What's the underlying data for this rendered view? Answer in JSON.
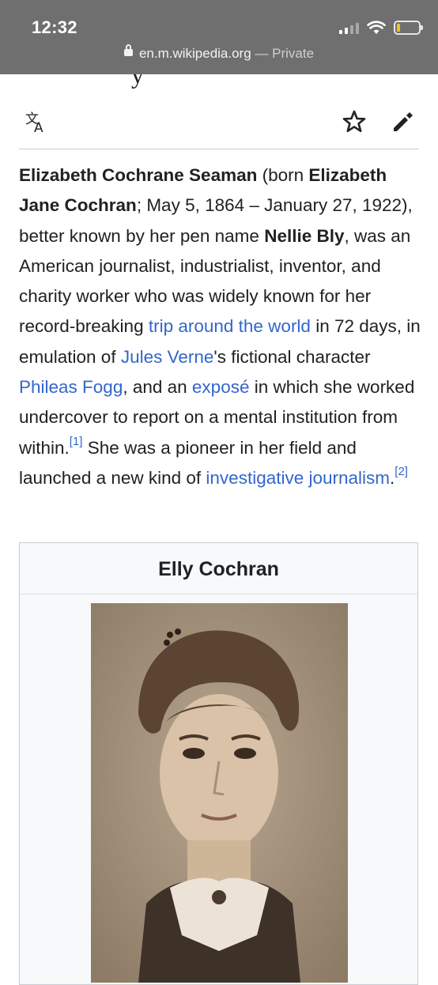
{
  "status": {
    "time": "12:32"
  },
  "browser": {
    "url": "en.m.wikipedia.org",
    "separator": " — ",
    "mode": "Private"
  },
  "page": {
    "heading_fragment": "y"
  },
  "toolbar": {
    "language_icon": "translate-icon",
    "watch_icon": "star-icon",
    "edit_icon": "pencil-icon"
  },
  "article": {
    "t1": "Elizabeth Cochrane Seaman",
    "t2": " (born ",
    "t3": "Elizabeth Jane Cochran",
    "t4": "; May 5, 1864 – January 27, 1922), better known by her pen name ",
    "t5": "Nellie Bly",
    "t6": ", was an American journalist, industrialist, inventor, and charity worker who was widely known for her record-breaking ",
    "link_trip": "trip around the world",
    "t7": " in 72 days, in emulation of ",
    "link_verne": "Jules Verne",
    "t8": "'s fictional character ",
    "link_fogg": "Phileas Fogg",
    "t9": ", and an ",
    "link_expose": "exposé",
    "t10": " in which she worked undercover to report on a mental institution from within.",
    "ref1": "[1]",
    "t11": " She was a pioneer in her field and launched a new kind of ",
    "link_investigative": "investigative journalism",
    "t12": ".",
    "ref2": "[2]"
  },
  "infobox": {
    "title": "Elly Cochran"
  },
  "colors": {
    "link": "#3366cc",
    "text": "#202122",
    "status_bar": "#6f6f6f",
    "infobox_bg": "#f8f9fa"
  }
}
